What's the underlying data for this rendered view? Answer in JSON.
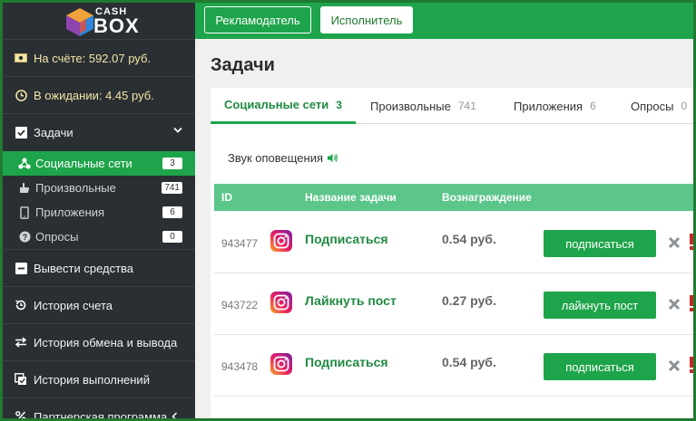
{
  "logo": {
    "top": "CASH",
    "bottom": "BOX"
  },
  "sidebar": {
    "balance": "На счёте: 592.07 руб.",
    "pending": "В ожидании: 4.45 руб.",
    "tasks_label": "Задачи",
    "sub_items": [
      {
        "label": "Социальные сети",
        "count": "3",
        "icon": "social-icon",
        "active": true
      },
      {
        "label": "Произвольные",
        "count": "741",
        "icon": "hand-icon",
        "active": false
      },
      {
        "label": "Приложения",
        "count": "6",
        "icon": "phone-icon",
        "active": false
      },
      {
        "label": "Опросы",
        "count": "0",
        "icon": "question-icon",
        "active": false
      }
    ],
    "withdraw": "Вывести средства",
    "history": "История счета",
    "exchange": "История обмена и вывода",
    "completed": "История выполнений",
    "partner": "Партнерская программа"
  },
  "topbar": {
    "advertiser": "Рекламодатель",
    "executor": "Исполнитель"
  },
  "main": {
    "title": "Задачи",
    "tabs": [
      {
        "label": "Социальные сети",
        "count": "3",
        "active": true
      },
      {
        "label": "Произвольные",
        "count": "741",
        "active": false
      },
      {
        "label": "Приложения",
        "count": "6",
        "active": false
      },
      {
        "label": "Опросы",
        "count": "0",
        "active": false
      }
    ],
    "sound_label": "Звук оповещения",
    "table": {
      "headers": {
        "id": "ID",
        "name": "Название задачи",
        "reward": "Вознаграждение"
      },
      "rows": [
        {
          "id": "943477",
          "name": "Подписаться",
          "reward": "0.54 руб.",
          "action": "подписаться"
        },
        {
          "id": "943722",
          "name": "Лайкнуть пост",
          "reward": "0.27 руб.",
          "action": "лайкнуть пост"
        },
        {
          "id": "943478",
          "name": "Подписаться",
          "reward": "0.54 руб.",
          "action": "подписаться"
        }
      ]
    }
  },
  "colors": {
    "accent": "#1ea44a",
    "sidebar": "#2a2f33",
    "table_header": "#5cc68a",
    "frame": "#1f7a2f"
  }
}
